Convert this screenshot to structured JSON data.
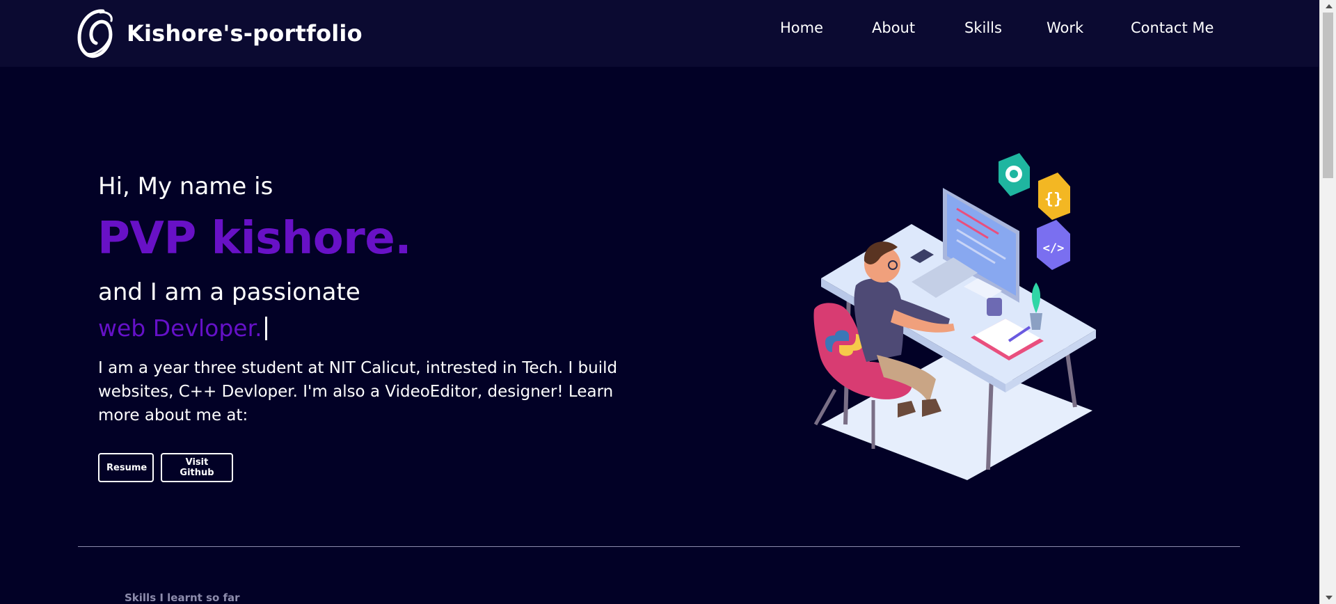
{
  "header": {
    "logo_icon": "swirl-logo-icon",
    "site_title": "Kishore's-portfolio",
    "nav": [
      {
        "label": "Home"
      },
      {
        "label": "About"
      },
      {
        "label": "Skills"
      },
      {
        "label": "Work"
      },
      {
        "label": "Contact Me"
      }
    ]
  },
  "hero": {
    "greeting": "Hi, My name is",
    "name": "PVP kishore.",
    "intro": "and I am a passionate",
    "role": "web Devloper.",
    "bio": "I am a year three student at NIT Calicut, intrested in Tech. I build websites, C++ Devloper. I'm also a VideoEditor, designer! Learn more about me at:",
    "buttons": {
      "resume": "Resume",
      "github": "Visit Github"
    },
    "illustration_icon": "developer-at-desk-illustration"
  },
  "skills": {
    "heading": "Skills I learnt so far"
  },
  "colors": {
    "background": "#020126",
    "navbar": "#0b0a31",
    "accent": "#6811c6",
    "text": "#ffffff",
    "muted": "#8d8cac"
  }
}
